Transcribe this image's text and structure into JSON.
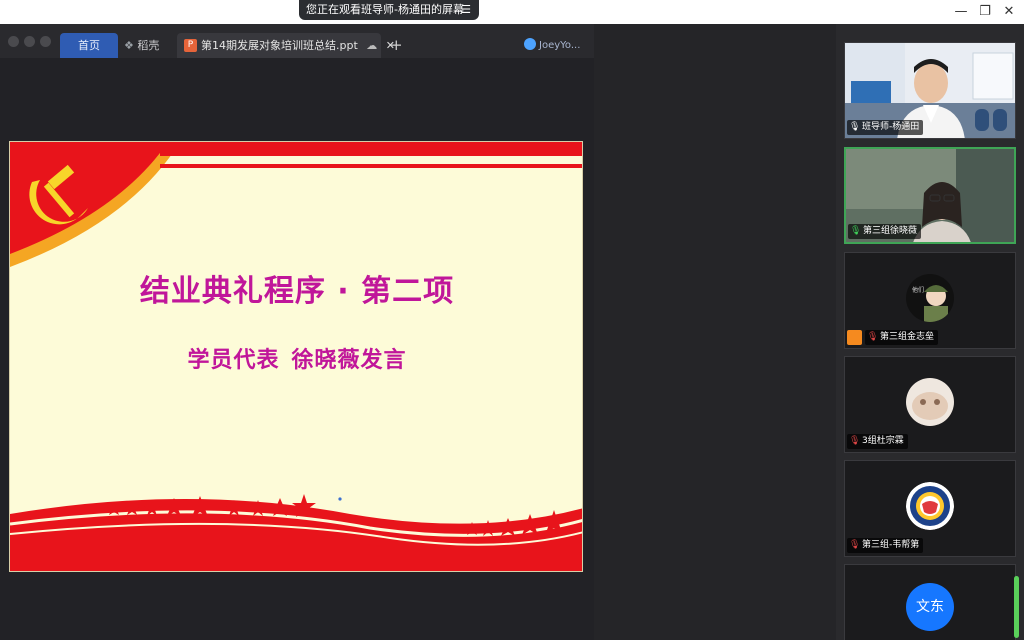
{
  "share_banner": {
    "text": "您正在观看班导师-杨通田的屏幕",
    "menu_icon": "menu-icon"
  },
  "window_controls": {
    "minimize": "—",
    "restore": "❐",
    "close": "✕"
  },
  "app": {
    "tabs": {
      "home": "首页",
      "wps": "稻壳",
      "document": "第14期发展对象培训班总结.ppt",
      "add": "+"
    },
    "user": "JoeyYo..."
  },
  "slide": {
    "title": "结业典礼程序 · 第二项",
    "subtitle_role": "学员代表",
    "subtitle_action": "徐晓薇发言",
    "colors": {
      "title": "#c0169a",
      "banner": "#e8141b",
      "background": "#fdfbd8"
    }
  },
  "participants": [
    {
      "name": "班导师-杨通田",
      "mic": "on",
      "video": true
    },
    {
      "name": "第三组徐晓薇",
      "mic": "active",
      "video": true
    },
    {
      "name": "第三组金志垒",
      "mic": "muted",
      "video": false,
      "host": true
    },
    {
      "name": "3组杜宗霖",
      "mic": "muted",
      "video": false
    },
    {
      "name": "第三组-韦帮第",
      "mic": "muted",
      "video": false
    },
    {
      "name": "",
      "avatar_text": "文东",
      "mic": "muted",
      "video": false
    }
  ]
}
